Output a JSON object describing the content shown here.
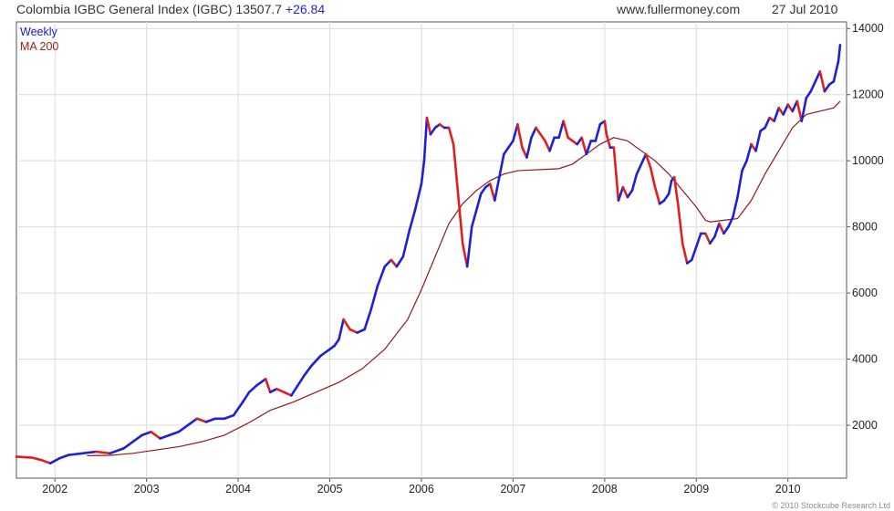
{
  "header": {
    "title": "Colombia IGBC General Index (IGBC) 13507.7",
    "change": "+26.84",
    "site": "www.fullermoney.com",
    "date": "27 Jul 2010"
  },
  "legend": {
    "weekly": "Weekly",
    "ma": "MA 200"
  },
  "copyright": "© 2010 Stockcube Research Ltd",
  "colors": {
    "up": "#1f1fd6",
    "down": "#e01e1e",
    "ma": "#8b1a1a",
    "grid": "#dcdcdc",
    "axis": "#555555"
  },
  "chart_data": {
    "type": "line",
    "x_axis": {
      "range": [
        2001.58,
        2010.64
      ],
      "ticks": [
        "2002",
        "2003",
        "2004",
        "2005",
        "2006",
        "2007",
        "2008",
        "2009",
        "2010"
      ],
      "tick_values": [
        2002,
        2003,
        2004,
        2005,
        2006,
        2007,
        2008,
        2009,
        2010
      ]
    },
    "y_axis": {
      "range": [
        400,
        14200
      ],
      "ticks": [
        "2000",
        "4000",
        "6000",
        "8000",
        "10000",
        "12000",
        "14000"
      ],
      "tick_values": [
        2000,
        4000,
        6000,
        8000,
        10000,
        12000,
        14000
      ],
      "position": "right"
    },
    "grid": true,
    "legend_position": "top-left",
    "series": [
      {
        "name": "Weekly",
        "x": [
          2001.58,
          2001.75,
          2001.85,
          2001.95,
          2002.05,
          2002.15,
          2002.3,
          2002.45,
          2002.6,
          2002.75,
          2002.85,
          2002.95,
          2003.05,
          2003.15,
          2003.25,
          2003.35,
          2003.45,
          2003.55,
          2003.65,
          2003.75,
          2003.85,
          2003.95,
          2004.0,
          2004.05,
          2004.12,
          2004.2,
          2004.25,
          2004.3,
          2004.35,
          2004.42,
          2004.5,
          2004.58,
          2004.65,
          2004.72,
          2004.8,
          2004.9,
          2005.0,
          2005.05,
          2005.1,
          2005.15,
          2005.22,
          2005.3,
          2005.38,
          2005.45,
          2005.52,
          2005.6,
          2005.67,
          2005.73,
          2005.8,
          2005.87,
          2005.93,
          2006.0,
          2006.03,
          2006.06,
          2006.1,
          2006.15,
          2006.2,
          2006.25,
          2006.3,
          2006.35,
          2006.4,
          2006.45,
          2006.5,
          2006.55,
          2006.6,
          2006.65,
          2006.7,
          2006.75,
          2006.8,
          2006.85,
          2006.9,
          2006.95,
          2007.0,
          2007.05,
          2007.1,
          2007.15,
          2007.2,
          2007.25,
          2007.3,
          2007.35,
          2007.4,
          2007.45,
          2007.5,
          2007.55,
          2007.6,
          2007.65,
          2007.7,
          2007.75,
          2007.8,
          2007.85,
          2007.9,
          2007.95,
          2008.0,
          2008.02,
          2008.06,
          2008.1,
          2008.15,
          2008.2,
          2008.25,
          2008.3,
          2008.35,
          2008.4,
          2008.45,
          2008.5,
          2008.55,
          2008.6,
          2008.65,
          2008.7,
          2008.73,
          2008.76,
          2008.8,
          2008.85,
          2008.9,
          2008.95,
          2009.0,
          2009.05,
          2009.1,
          2009.15,
          2009.2,
          2009.25,
          2009.3,
          2009.35,
          2009.4,
          2009.45,
          2009.5,
          2009.55,
          2009.6,
          2009.65,
          2009.7,
          2009.75,
          2009.8,
          2009.85,
          2009.9,
          2009.95,
          2010.0,
          2010.05,
          2010.1,
          2010.15,
          2010.2,
          2010.25,
          2010.3,
          2010.35,
          2010.4,
          2010.45,
          2010.5,
          2010.55,
          2010.57
        ],
        "values": [
          1050,
          1020,
          950,
          850,
          1000,
          1100,
          1150,
          1200,
          1150,
          1300,
          1500,
          1700,
          1800,
          1600,
          1700,
          1800,
          2000,
          2200,
          2100,
          2200,
          2200,
          2300,
          2500,
          2700,
          3000,
          3200,
          3300,
          3400,
          3000,
          3100,
          3000,
          2900,
          3200,
          3500,
          3800,
          4100,
          4300,
          4400,
          4600,
          5200,
          4900,
          4800,
          4900,
          5500,
          6200,
          6800,
          7000,
          6800,
          7100,
          7900,
          8500,
          9300,
          10000,
          11300,
          10800,
          11000,
          11100,
          11000,
          11000,
          10500,
          9000,
          7500,
          6800,
          8000,
          8500,
          9000,
          9200,
          9300,
          8800,
          9500,
          10200,
          10400,
          10600,
          11100,
          10400,
          10100,
          10700,
          11000,
          10800,
          10600,
          10300,
          10700,
          10700,
          11200,
          10700,
          10600,
          10500,
          10700,
          10200,
          10600,
          10600,
          11100,
          11200,
          10800,
          10400,
          10400,
          8800,
          9200,
          8900,
          9100,
          9600,
          9900,
          10200,
          9800,
          9200,
          8700,
          8800,
          9000,
          9400,
          9500,
          8700,
          7500,
          6900,
          7000,
          7400,
          7800,
          7800,
          7500,
          7700,
          8100,
          7800,
          8000,
          8300,
          8900,
          9700,
          10000,
          10500,
          10300,
          10900,
          11000,
          11300,
          11200,
          11600,
          11400,
          11700,
          11500,
          11800,
          11200,
          11900,
          12100,
          12400,
          12700,
          12100,
          12300,
          12400,
          13000,
          13500
        ]
      },
      {
        "name": "MA 200",
        "x": [
          2002.35,
          2002.6,
          2002.85,
          2003.1,
          2003.35,
          2003.6,
          2003.85,
          2004.1,
          2004.35,
          2004.6,
          2004.85,
          2005.1,
          2005.35,
          2005.6,
          2005.85,
          2006.0,
          2006.15,
          2006.3,
          2006.45,
          2006.6,
          2006.75,
          2006.9,
          2007.05,
          2007.2,
          2007.35,
          2007.5,
          2007.65,
          2007.8,
          2007.95,
          2008.1,
          2008.25,
          2008.4,
          2008.55,
          2008.7,
          2008.85,
          2009.0,
          2009.1,
          2009.15,
          2009.3,
          2009.45,
          2009.6,
          2009.75,
          2009.9,
          2010.05,
          2010.2,
          2010.35,
          2010.5,
          2010.57
        ],
        "values": [
          1080,
          1090,
          1150,
          1250,
          1350,
          1500,
          1700,
          2050,
          2450,
          2700,
          3000,
          3300,
          3700,
          4300,
          5200,
          6100,
          7100,
          8100,
          8700,
          9100,
          9400,
          9600,
          9700,
          9720,
          9740,
          9760,
          9900,
          10200,
          10500,
          10700,
          10600,
          10300,
          10000,
          9600,
          9100,
          8600,
          8200,
          8150,
          8200,
          8250,
          8800,
          9600,
          10300,
          11000,
          11400,
          11500,
          11600,
          11800
        ]
      }
    ]
  }
}
